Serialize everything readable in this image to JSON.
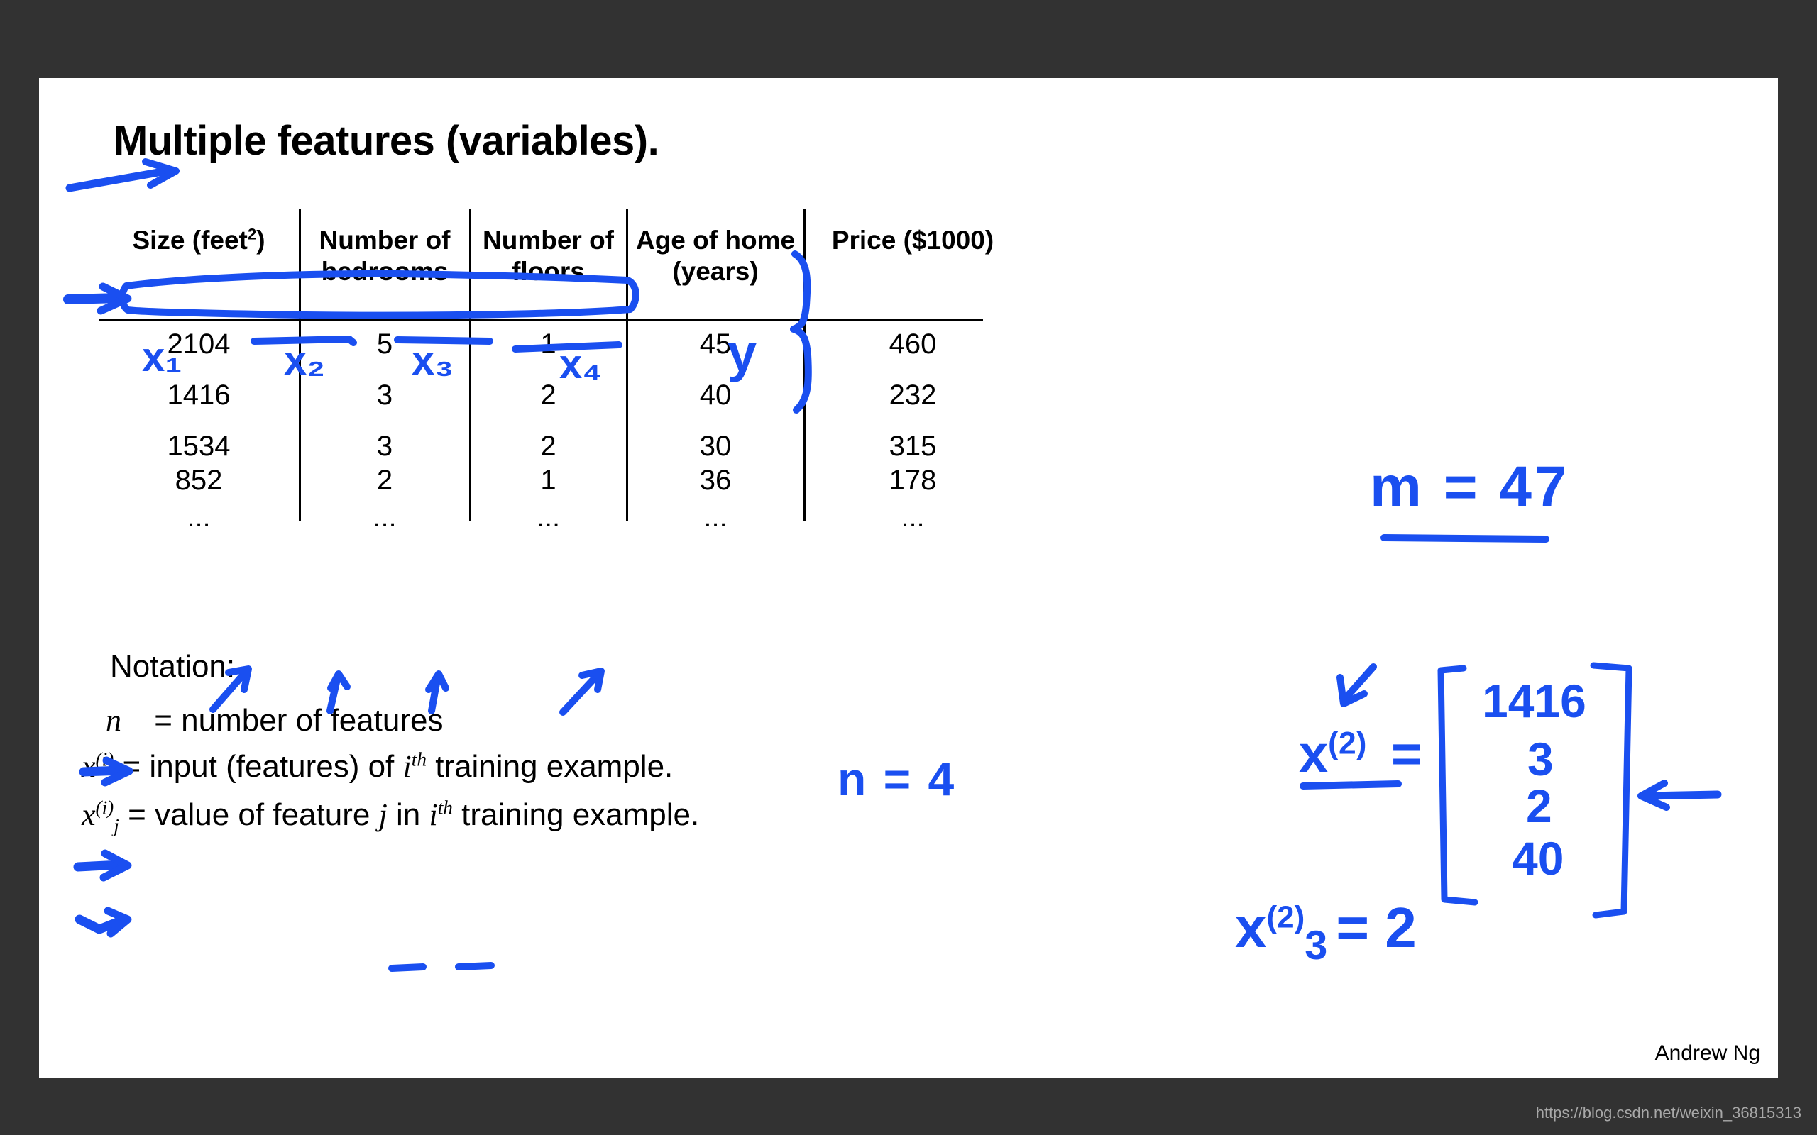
{
  "slide": {
    "title": "Multiple features (variables).",
    "author": "Andrew Ng",
    "watermark": "https://blog.csdn.net/weixin_36815313",
    "ink_color": "#1a4ff0",
    "background_color": "#323232",
    "slide_color": "#ffffff"
  },
  "table": {
    "columns": [
      {
        "line1": "Size (feet",
        "sup": "2",
        "line2": ")",
        "header": "Size (feet2)",
        "symbol": "x",
        "symbol_sub": "1"
      },
      {
        "line1": "Number of",
        "line2": "bedrooms",
        "header": "Number of bedrooms",
        "symbol": "x",
        "symbol_sub": "2"
      },
      {
        "line1": "Number of",
        "line2": "floors",
        "header": "Number of floors",
        "symbol": "x",
        "symbol_sub": "3"
      },
      {
        "line1": "Age of home",
        "line2": "(years)",
        "header": "Age of home (years)",
        "symbol": "x",
        "symbol_sub": "4"
      },
      {
        "line1": "Price ($1000)",
        "line2": "",
        "header": "Price ($1000)",
        "symbol": "y",
        "symbol_sub": ""
      }
    ],
    "rows": [
      [
        "2104",
        "5",
        "1",
        "45",
        "460"
      ],
      [
        "1416",
        "3",
        "2",
        "40",
        "232"
      ],
      [
        "1534",
        "3",
        "2",
        "30",
        "315"
      ],
      [
        "852",
        "2",
        "1",
        "36",
        "178"
      ],
      [
        "...",
        "...",
        "...",
        "...",
        "..."
      ]
    ]
  },
  "notation": {
    "heading": "Notation:",
    "items": [
      {
        "symbol": "n",
        "sup": "",
        "sub": "",
        "text": "= number of features"
      },
      {
        "symbol": "x",
        "sup": "(i)",
        "sub": "",
        "text_a": "= input (features) of ",
        "italic_mid": "i",
        "italic_mid_sup": "th",
        "text_b": " training example."
      },
      {
        "symbol": "x",
        "sup": "(i)",
        "sub": "j",
        "text_a": "= value of feature ",
        "italic_mid": "j",
        "italic_mid_sup": "",
        "text_b2": " in ",
        "italic_mid2": "i",
        "italic_mid2_sup": "th",
        "text_b": " training example."
      }
    ]
  },
  "annotations": {
    "x1": "x₁",
    "x2": "x₂",
    "x3": "x₃",
    "x4": "x₄",
    "y": "y",
    "m_equals": "m = 47",
    "n_equals": "n = 4",
    "x_superscript_2": "x",
    "x_superscript_2_sup": "(2)",
    "equals": "=",
    "vector_values": [
      "1416",
      "3",
      "2",
      "40"
    ],
    "x3_2_base": "x",
    "x3_2_sup": "(2)",
    "x3_2_sub": "3",
    "x3_2_rhs": "= 2"
  }
}
